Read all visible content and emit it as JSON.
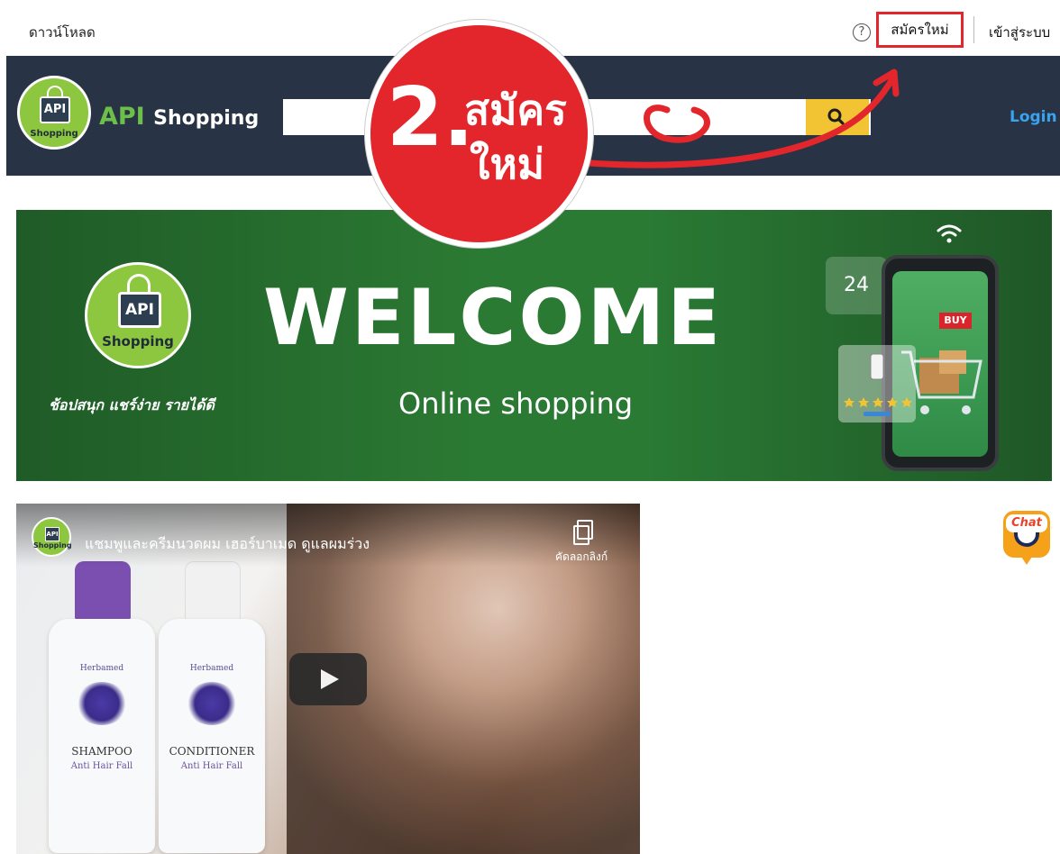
{
  "topbar": {
    "download_label": "ดาวน์โหลด",
    "help_icon_glyph": "?",
    "register_label": "สมัครใหม่",
    "login_label": "เข้าสู่ระบบ"
  },
  "header": {
    "logo_badge_text": "API",
    "logo_small_text": "Shopping",
    "brand_part1": "API",
    "brand_part2": "Shopping",
    "search_value": "",
    "search_icon": "search-icon",
    "login_label": "Login",
    "bg_color": "#283445",
    "search_button_color": "#f2c433",
    "brand_color": "#6cc04a"
  },
  "annotation": {
    "step_number": "2.",
    "line1": "สมัคร",
    "line2": "ใหม่",
    "color": "#e3262b"
  },
  "banner": {
    "logo_badge_text": "API",
    "logo_small_text": "Shopping",
    "tagline": "ช้อปสนุก แชร์ง่าย รายได้ดี",
    "headline": "WELCOME",
    "subheadline": "Online shopping",
    "call_badge": "24",
    "buy_label": "BUY"
  },
  "video": {
    "channel_avatar_text": "API",
    "channel_avatar_small": "Shopping",
    "title": "แชมพูและครีมนวดผม เฮอร์บาเมด ดูแลผมร่วง",
    "copy_link_label": "คัดลอกลิงก์",
    "products": [
      {
        "brand": "Herbamed",
        "name": "SHAMPOO",
        "sub": "Anti Hair Fall",
        "cap_color": "#7b4fb0"
      },
      {
        "brand": "Herbamed",
        "name": "CONDITIONER",
        "sub": "Anti Hair Fall",
        "cap_color": "#f1f1f1"
      }
    ]
  },
  "chat": {
    "label": "Chat"
  }
}
